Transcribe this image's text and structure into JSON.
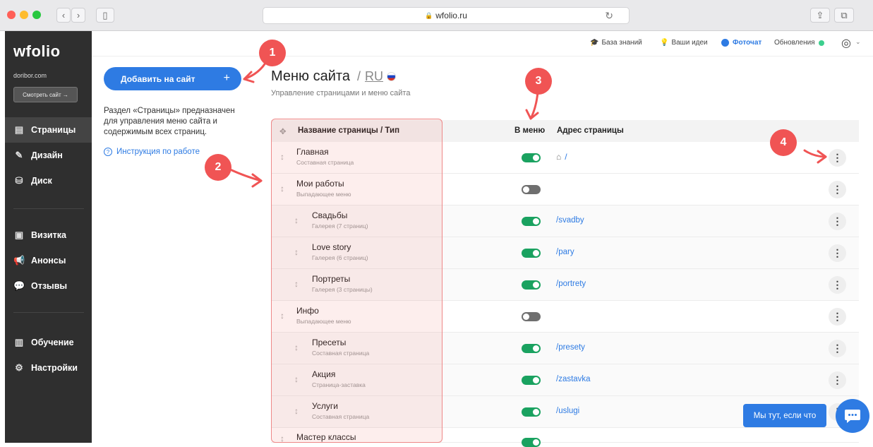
{
  "browser": {
    "url": "wfolio.ru"
  },
  "sidebar": {
    "logo": "wfolio",
    "domain": "doribor.com",
    "view_site": "Смотреть сайт →",
    "items": [
      {
        "label": "Страницы",
        "icon": "page-icon"
      },
      {
        "label": "Дизайн",
        "icon": "brush-icon"
      },
      {
        "label": "Диск",
        "icon": "disk-icon"
      },
      {
        "label": "Визитка",
        "icon": "card-icon"
      },
      {
        "label": "Анонсы",
        "icon": "megaphone-icon"
      },
      {
        "label": "Отзывы",
        "icon": "chat-icon"
      },
      {
        "label": "Обучение",
        "icon": "book-icon"
      },
      {
        "label": "Настройки",
        "icon": "gear-icon"
      }
    ]
  },
  "topbar": {
    "knowledge": "База знаний",
    "ideas": "Ваши идеи",
    "photochat": "Фоточат",
    "updates": "Обновления"
  },
  "left_panel": {
    "add_button": "Добавить на сайт",
    "add_plus": "+",
    "description": "Раздел «Страницы» предназначен для управления меню сайта и содержимым всех страниц.",
    "help_link": "Инструкция по работе"
  },
  "main": {
    "title": "Меню сайта",
    "lang_sep": "/",
    "lang": "RU",
    "subtitle": "Управление страницами и меню сайта",
    "columns": {
      "name": "Название страницы / Тип",
      "in_menu": "В меню",
      "address": "Адрес страницы"
    },
    "rows": [
      {
        "name": "Главная",
        "type": "Составная страница",
        "in_menu": true,
        "url": "/"
      },
      {
        "name": "Мои работы",
        "type": "Выпадающее меню",
        "in_menu": false,
        "url": ""
      },
      {
        "name": "Свадьбы",
        "type": "Галерея (7 страниц)",
        "in_menu": true,
        "url": "/svadby"
      },
      {
        "name": "Love story",
        "type": "Галерея (6 страниц)",
        "in_menu": true,
        "url": "/pary"
      },
      {
        "name": "Портреты",
        "type": "Галерея (3 страницы)",
        "in_menu": true,
        "url": "/portrety"
      },
      {
        "name": "Инфо",
        "type": "Выпадающее меню",
        "in_menu": false,
        "url": ""
      },
      {
        "name": "Пресеты",
        "type": "Составная страница",
        "in_menu": true,
        "url": "/presety"
      },
      {
        "name": "Акция",
        "type": "Страница-заставка",
        "in_menu": true,
        "url": "/zastavka"
      },
      {
        "name": "Услуги",
        "type": "Составная страница",
        "in_menu": true,
        "url": "/uslugi"
      },
      {
        "name": "Мастер классы",
        "type": "",
        "in_menu": true,
        "url": ""
      }
    ]
  },
  "annotations": [
    "1",
    "2",
    "3",
    "4"
  ],
  "chat": {
    "label": "Мы тут, если что"
  }
}
